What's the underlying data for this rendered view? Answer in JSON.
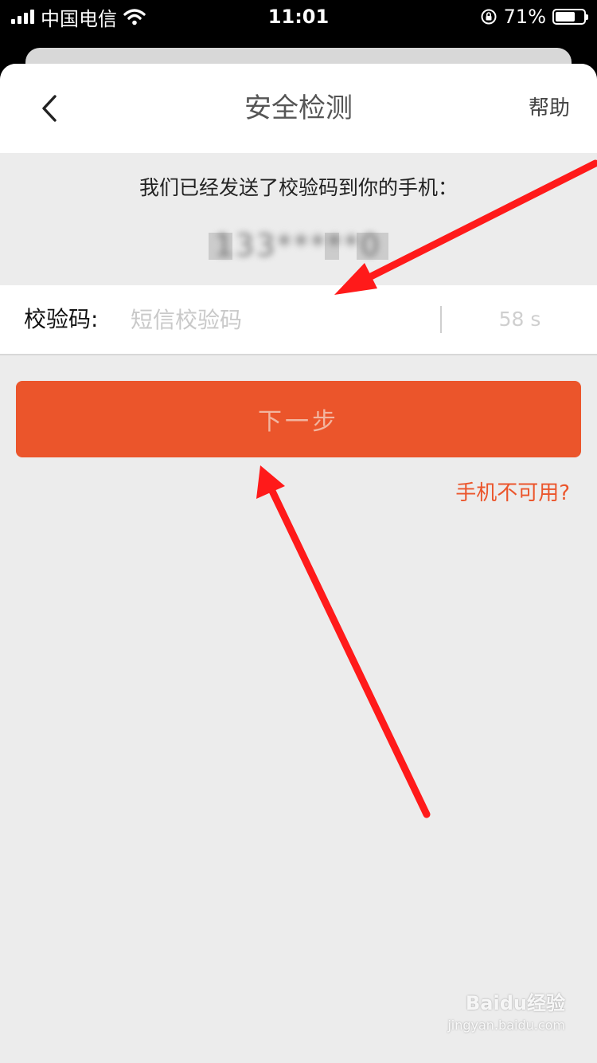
{
  "status_bar": {
    "carrier": "中国电信",
    "time": "11:01",
    "battery_percent": "71%",
    "battery_level": 0.71,
    "icons": [
      "signal-icon",
      "wifi-icon",
      "rotation-lock-icon",
      "battery-icon"
    ]
  },
  "nav": {
    "title": "安全检测",
    "help": "帮助",
    "back_icon": "chevron-left-icon"
  },
  "content": {
    "info_text": "我们已经发送了校验码到你的手机：",
    "phone_masked": "133*****0"
  },
  "code_field": {
    "label": "校验码:",
    "placeholder": "短信校验码",
    "value": "",
    "countdown": "58 s"
  },
  "actions": {
    "next_label": "下一步",
    "phone_unavailable": "手机不可用?"
  },
  "colors": {
    "accent": "#eb552b",
    "background": "#ececec",
    "annotation_arrow": "#ff1a1a"
  },
  "watermark": {
    "logo": "Baidu经验",
    "url": "jingyan.baidu.com"
  }
}
